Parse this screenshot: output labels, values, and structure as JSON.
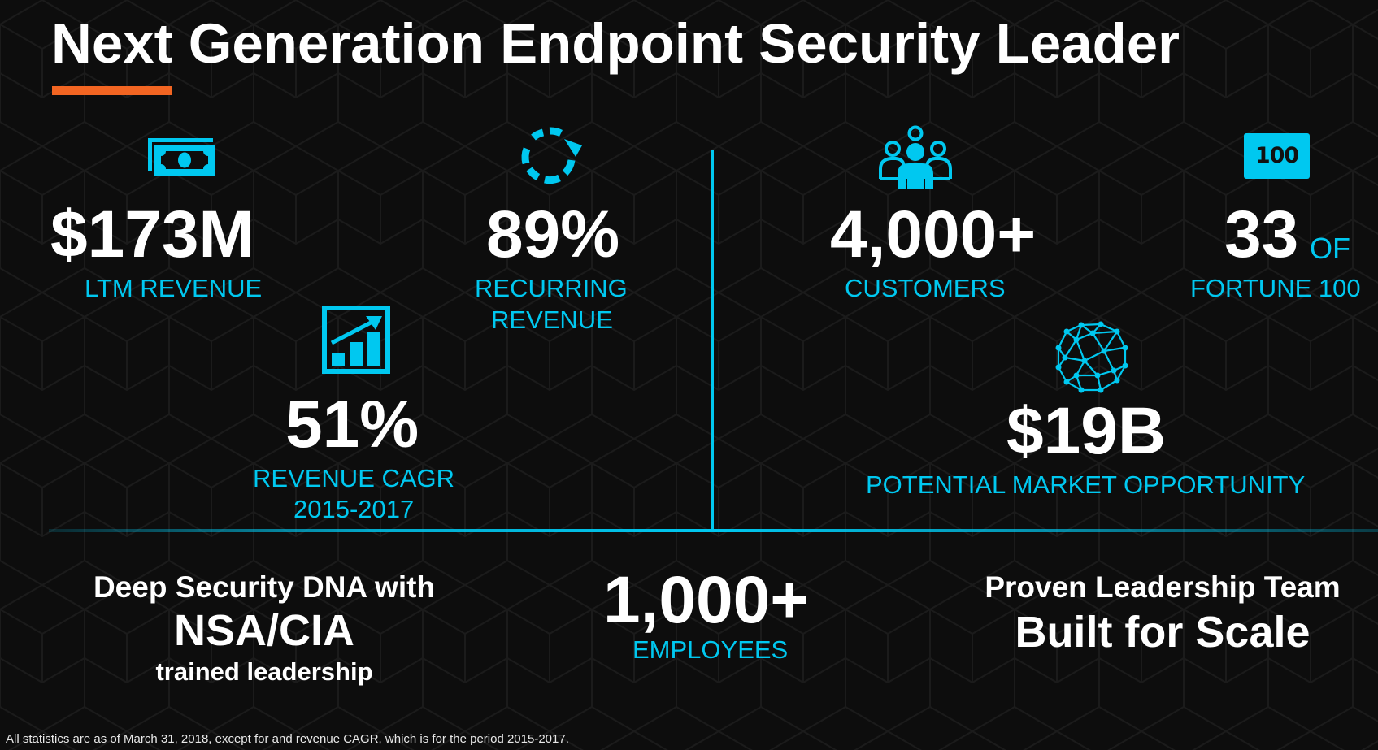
{
  "title": "Next Generation Endpoint Security Leader",
  "colors": {
    "background": "#0d0d0d",
    "accent_cyan": "#00c8f0",
    "accent_orange": "#f26522",
    "text_white": "#ffffff"
  },
  "stats": {
    "ltm_revenue": {
      "icon": "money-bills-icon",
      "value": "$173M",
      "label": "LTM REVENUE"
    },
    "recurring_revenue": {
      "icon": "circular-arrows-icon",
      "value": "89%",
      "label_line1": "RECURRING",
      "label_line2": "REVENUE"
    },
    "revenue_cagr": {
      "icon": "growth-chart-icon",
      "value": "51%",
      "label_line1": "REVENUE CAGR",
      "label_line2": "2015-2017"
    },
    "customers": {
      "icon": "people-group-icon",
      "value": "4,000+",
      "label": "CUSTOMERS"
    },
    "fortune": {
      "icon": "fortune-100-badge-icon",
      "badge_text": "100",
      "value": "33",
      "suffix": "OF",
      "label": "FORTUNE 100"
    },
    "market": {
      "icon": "network-sphere-icon",
      "value": "$19B",
      "label": "POTENTIAL MARKET OPPORTUNITY"
    }
  },
  "bottom": {
    "dna": {
      "line1": "Deep Security DNA with",
      "line2": "NSA/CIA",
      "line3": "trained leadership"
    },
    "employees": {
      "value": "1,000+",
      "label": "EMPLOYEES"
    },
    "leadership": {
      "line1": "Proven Leadership Team",
      "line2": "Built for Scale"
    }
  },
  "footnote": "All statistics are as of March 31, 2018, except for and revenue CAGR, which is for the period 2015-2017."
}
